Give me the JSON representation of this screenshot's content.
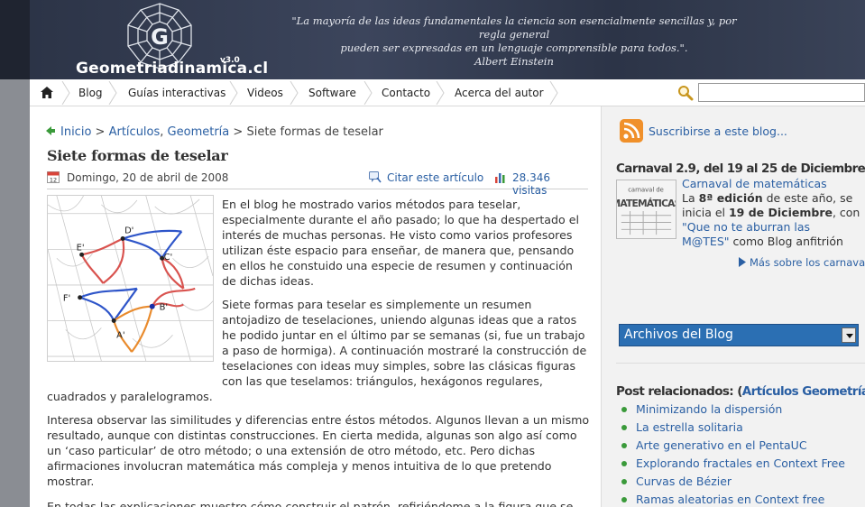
{
  "header": {
    "site_name": "Geometriadinamica.cl",
    "version": "v3.0",
    "quote_line1": "\"La mayoría de las ideas fundamentales la ciencia son esencialmente sencillas y, por regla general",
    "quote_line2": "pueden ser expresadas en un lenguaje comprensible para todos.\".",
    "quote_author": "Albert Einstein"
  },
  "nav": {
    "items": [
      "Blog",
      "Guías interactivas",
      "Videos",
      "Software",
      "Contacto",
      "Acerca del autor"
    ],
    "search_value": ""
  },
  "breadcrumb": {
    "home": "Inicio",
    "sep1": ">",
    "articles": "Artículos",
    "comma": ",",
    "category": "Geometría",
    "sep2": ">",
    "current": "Siete formas de teselar"
  },
  "post": {
    "title": "Siete formas de teselar",
    "date": "Domingo, 20 de abril de 2008",
    "cite_label": "Citar este artículo",
    "visits": "28.346 visitas",
    "figure_labels": [
      "D'",
      "E'",
      "C'",
      "F'",
      "B'",
      "A'"
    ],
    "para1": [
      "En el blog he mostrado varios métodos para teselar,",
      "especialmente durante el año pasado; lo que ha despertado el",
      "interés de muchas personas. He visto como varios profesores",
      "utilizan éste espacio para enseñar, de manera que, pensando",
      "en ellos he constuido una especie de resumen y continuación",
      "de dichas ideas."
    ],
    "para2": [
      "Siete formas para teselar es simplemente un resumen",
      "antojadizo de teselaciones, uniendo algunas ideas que a ratos",
      "he podido juntar en el último par se semanas (si, fue un trabajo",
      "a paso de hormiga). A continuación mostraré la construcción de",
      "teselaciones con ideas muy simples, sobre las clásicas figuras",
      "con las que teselamos: triángulos, hexágonos regulares,",
      "cuadrados y paralelogramos."
    ],
    "para3": [
      "Interesa observar las similitudes y diferencias entre éstos métodos. Algunos llevan a un mismo",
      "resultado, aunque con distintas construcciones. En cierta medida, algunas son algo así como",
      "un ‘caso particular’ de otro método; o una extensión de otro método, etc. Pero dichas",
      "afirmaciones involucran matemática más compleja y menos intuitiva de lo que pretendo",
      "mostrar."
    ],
    "para4": [
      "En todas las explicaciones muestro cómo construir el patrón, refiriéndome a la figura que se"
    ]
  },
  "sidebar": {
    "subscribe": "Suscribirse a este blog...",
    "carnaval_title": "Carnaval 2.9, del 19 al 25 de Diciembre",
    "carnaval_logo_text": [
      "carnaval de",
      "MATEMÁTICAS"
    ],
    "carnaval_link": "Carnaval de matemáticas",
    "carnaval_text_a": "La ",
    "carnaval_edition": "8ª edición",
    "carnaval_text_b": " de este año, se",
    "carnaval_text_c": "inicia el ",
    "carnaval_date": "19 de Diciembre",
    "carnaval_text_d": ", con",
    "carnaval_blog": "\"Que no te aburran las",
    "carnaval_blog2": "M@TES\"",
    "carnaval_text_e": " como Blog anfitrión",
    "carnaval_more": "Más sobre los carnavales...",
    "archive_label": "Archivos del Blog",
    "related_prefix": "Post relacionados: (",
    "related_link": "Artículos Geometría",
    "related_suffix": ")",
    "related": [
      "Minimizando la dispersión",
      "La estrella solitaria",
      "Arte generativo en el PentaUC",
      "Explorando fractales en Context Free",
      "Curvas de Bézier",
      "Ramas aleatorias en Context free"
    ]
  },
  "colors": {
    "link": "#2a5fa3",
    "header_bg": "#2a3245",
    "rss": "#f0902a",
    "archive_select": "#2b6fb3",
    "bullet": "#3a9a3a",
    "tile_red": "#d9534f",
    "tile_blue": "#2e55c9",
    "tile_orange": "#e98b2d"
  },
  "icons": {
    "home": "home-icon",
    "search": "magnifier-icon",
    "calendar": "calendar-icon",
    "cite": "quote-bubble-icon",
    "visits": "bar-chart-icon",
    "rss": "rss-icon",
    "back": "back-arrow-icon",
    "more": "arrow-right-icon"
  }
}
